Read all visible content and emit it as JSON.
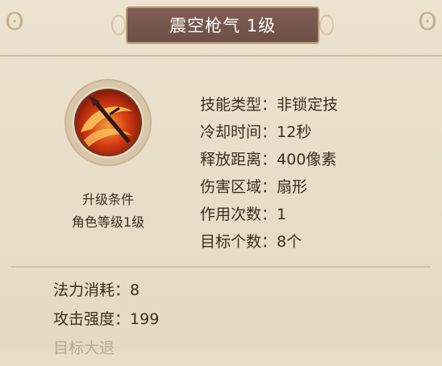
{
  "title": "震空枪气 1级",
  "skill_icon": "spear-skill-icon",
  "upgrade": {
    "title": "升级条件",
    "requirement": "角色等级1级"
  },
  "stats": [
    {
      "label": "技能类型：",
      "value": "非锁定技"
    },
    {
      "label": "冷却时间：",
      "value": "12秒"
    },
    {
      "label": "释放距离：",
      "value": "400像素"
    },
    {
      "label": "伤害区域：",
      "value": "扇形"
    },
    {
      "label": "作用次数：",
      "value": "1"
    },
    {
      "label": "目标个数：",
      "value": "8个"
    }
  ],
  "bottom_stats": [
    {
      "label": "法力消耗：",
      "value": "8"
    },
    {
      "label": "攻击强度：",
      "value": "199"
    }
  ],
  "bottom_partial": "目标大退"
}
